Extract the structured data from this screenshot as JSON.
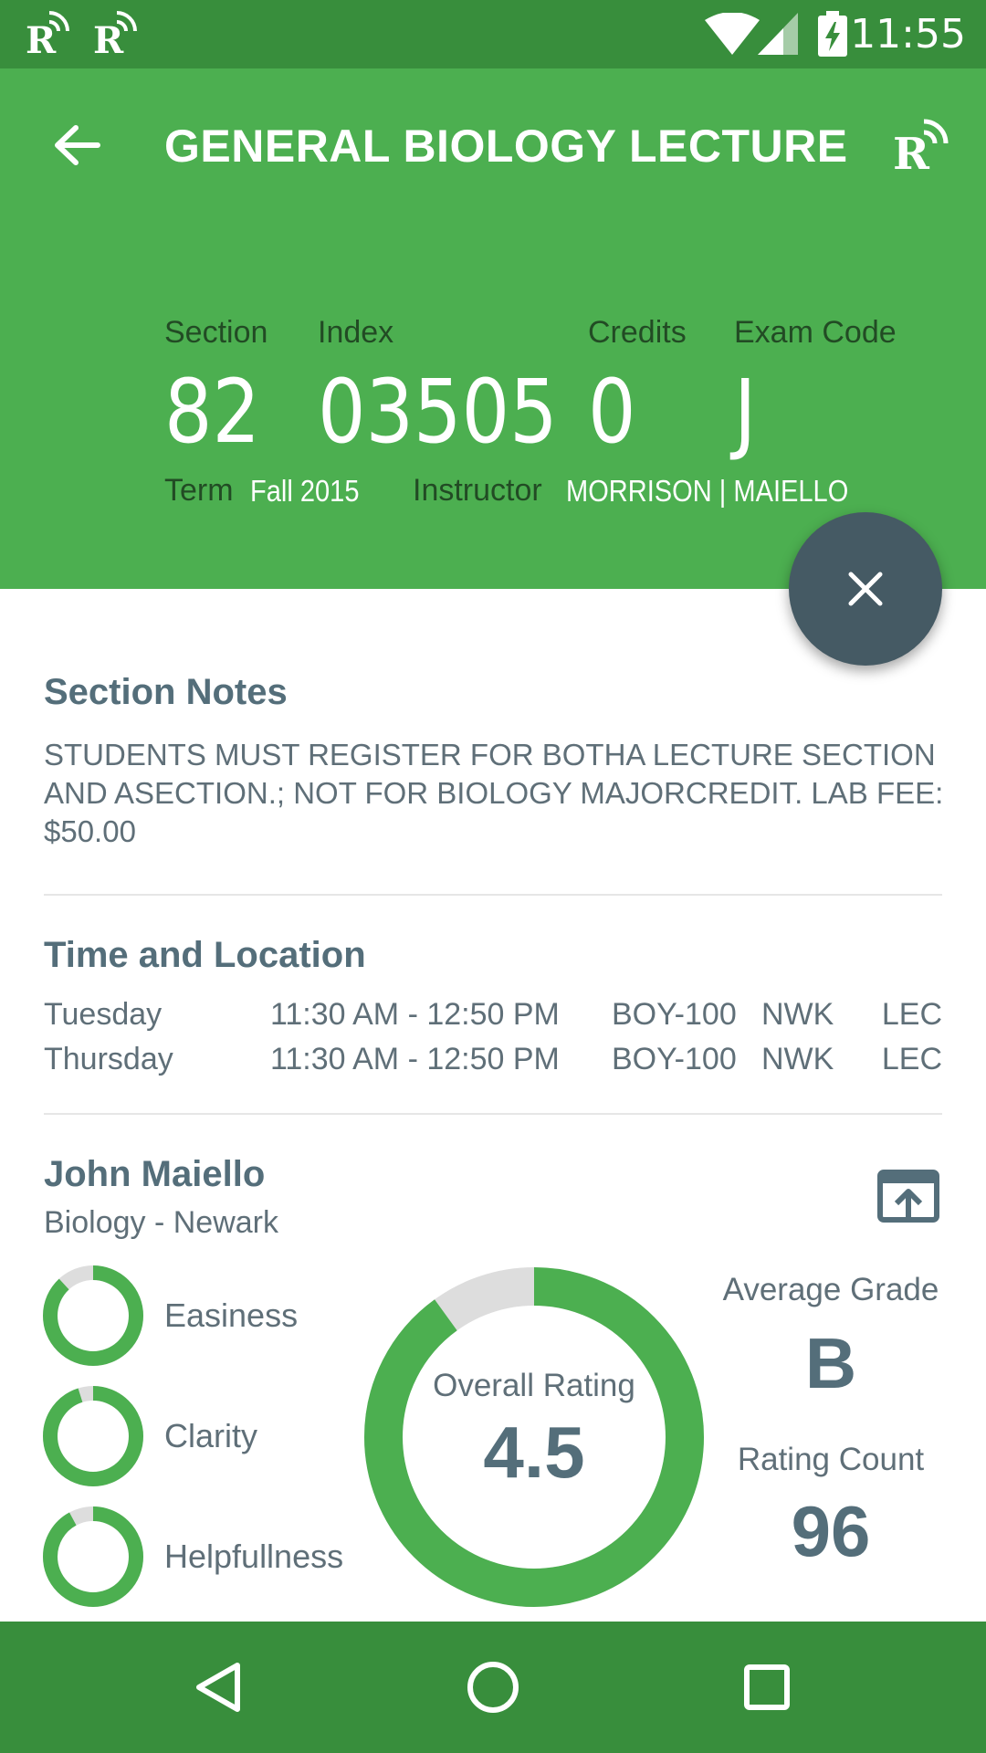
{
  "status_bar": {
    "time": "11:55"
  },
  "header": {
    "title": "GENERAL BIOLOGY LECTURE",
    "section_label": "Section",
    "section_value": "82",
    "index_label": "Index",
    "index_value": "03505",
    "credits_label": "Credits",
    "credits_value": "0",
    "exam_code_label": "Exam Code",
    "exam_code_value": "J",
    "term_label": "Term",
    "term_value": "Fall 2015",
    "instructor_label": "Instructor",
    "instructor_value": "MORRISON | MAIELLO"
  },
  "section_notes": {
    "title": "Section Notes",
    "text": "STUDENTS MUST REGISTER FOR BOTHA LECTURE SECTION AND ASECTION.; NOT FOR BIOLOGY MAJORCREDIT. LAB FEE: $50.00"
  },
  "time_location": {
    "title": "Time and Location",
    "rows": [
      {
        "day": "Tuesday",
        "time": "11:30 AM - 12:50 PM",
        "room": "BOY-100",
        "campus": "NWK",
        "type": "LEC"
      },
      {
        "day": "Thursday",
        "time": "11:30 AM - 12:50 PM",
        "room": "BOY-100",
        "campus": "NWK",
        "type": "LEC"
      }
    ]
  },
  "instructor": {
    "name": "John Maiello",
    "department": "Biology - Newark",
    "ratings": [
      {
        "label": "Easiness",
        "fraction": 0.88
      },
      {
        "label": "Clarity",
        "fraction": 0.95
      },
      {
        "label": "Helpfullness",
        "fraction": 0.92
      }
    ],
    "overall_label": "Overall Rating",
    "overall_value": "4.5",
    "overall_fraction": 0.9,
    "average_grade_label": "Average Grade",
    "average_grade_value": "B",
    "rating_count_label": "Rating Count",
    "rating_count_value": "96"
  },
  "colors": {
    "primary": "#4caf50",
    "primary_dark": "#388e3c",
    "accent": "#455a64",
    "ring_track": "#dddddd"
  }
}
